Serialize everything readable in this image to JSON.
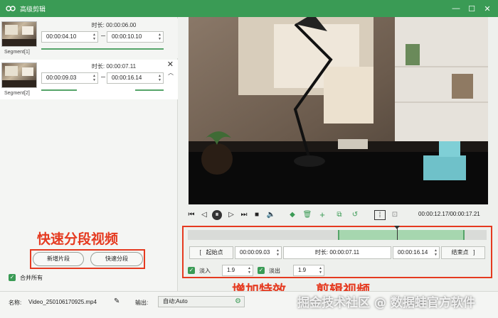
{
  "window": {
    "title": "高级剪辑"
  },
  "segments": [
    {
      "label": "Segment[1]",
      "duration_label": "时长:",
      "duration": "00:00:06.00",
      "start": "00:00:04.10",
      "end": "00:00:10.10"
    },
    {
      "label": "Segment[2]",
      "duration_label": "时长:",
      "duration": "00:00:07.11",
      "start": "00:00:09.03",
      "end": "00:00:16.14"
    }
  ],
  "left_actions": {
    "add_segment": "新增片段",
    "quick_split": "快速分段",
    "merge_all": "合并所有"
  },
  "annotations": {
    "quick_split_video": "快速分段视频",
    "add_effects": "增加特效",
    "clip_video": "剪辑视频"
  },
  "player": {
    "timecode": "00:00:12.17/00:00:17.21",
    "playhead_fraction": 0.6995,
    "selection_start_fraction": 0.5024,
    "selection_end_fraction": 0.9262
  },
  "clip": {
    "start_bracket": "[",
    "start_label": "起始点",
    "start_value": "00:00:09.03",
    "duration_label": "时长:",
    "duration_value": "00:00:07.11",
    "end_value": "00:00:16.14",
    "end_label": "结束点",
    "end_bracket": "]",
    "fade_in_label": "淡入",
    "fade_in_value": "1.9",
    "fade_out_label": "淡出",
    "fade_out_value": "1.9"
  },
  "bottom": {
    "name_label": "名称:",
    "file_name": "Video_250106170925.mp4",
    "output_label": "输出:",
    "output_value": "自动;Auto"
  },
  "watermark": "掘金技术社区 @ 数据蛙官方软件",
  "colors": {
    "title_bar": "#3a9b55",
    "accent": "#55a469",
    "annotation": "#e53a20"
  }
}
